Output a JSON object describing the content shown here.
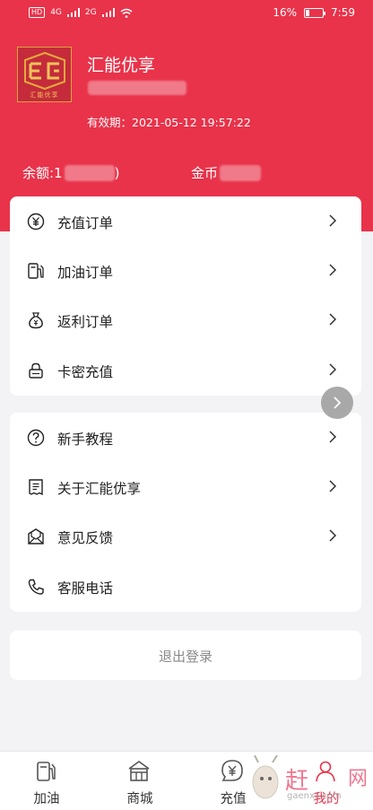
{
  "status_bar": {
    "network_left": "HD",
    "signal1": "4G",
    "signal2": "2G",
    "battery_percent": "16%",
    "time": "7:59"
  },
  "profile": {
    "app_name": "汇能优享",
    "logo_text": "汇能优享",
    "expiry_label": "有效期：",
    "expiry_value": "2021-05-12 19:57:22",
    "balance_label": "余额:1",
    "balance_suffix": ")",
    "coins_label": "金币"
  },
  "menu1": [
    {
      "label": "充值订单",
      "icon": "yuan-icon"
    },
    {
      "label": "加油订单",
      "icon": "fuel-pump-icon"
    },
    {
      "label": "返利订单",
      "icon": "money-bag-icon"
    },
    {
      "label": "卡密充值",
      "icon": "lock-icon"
    }
  ],
  "menu2": [
    {
      "label": "新手教程",
      "icon": "help-icon"
    },
    {
      "label": "关于汇能优享",
      "icon": "document-icon"
    },
    {
      "label": "意见反馈",
      "icon": "feedback-icon"
    },
    {
      "label": "客服电话",
      "icon": "phone-icon"
    }
  ],
  "logout_label": "退出登录",
  "tabs": [
    {
      "label": "加油",
      "icon": "fuel-pump-icon"
    },
    {
      "label": "商城",
      "icon": "store-icon"
    },
    {
      "label": "充值",
      "icon": "recharge-icon"
    },
    {
      "label": "我的",
      "icon": "profile-icon"
    }
  ],
  "watermark": {
    "brand": "赶",
    "site": "gaenxz.com",
    "extra": "网"
  },
  "colors": {
    "brand_red": "#e8334a",
    "background": "#f3f3f5",
    "logout_text": "#8a8a8a"
  }
}
